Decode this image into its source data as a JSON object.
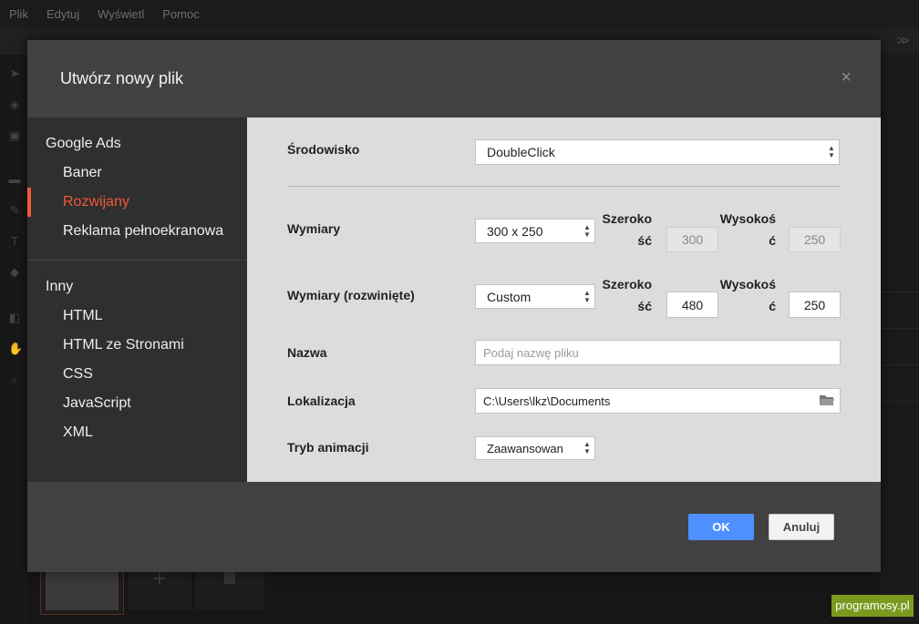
{
  "menu": [
    "Plik",
    "Edytuj",
    "Wyświetl",
    "Pomoc"
  ],
  "badge": "programosy.pl",
  "dialog": {
    "title": "Utwórz nowy plik",
    "close": "×",
    "sidebar": {
      "group1": {
        "title": "Google Ads",
        "items": [
          "Baner",
          "Rozwijany",
          "Reklama pełnoekranowa"
        ]
      },
      "group2": {
        "title": "Inny",
        "items": [
          "HTML",
          "HTML ze Stronami",
          "CSS",
          "JavaScript",
          "XML"
        ]
      },
      "active": "Rozwijany"
    },
    "form": {
      "environment": {
        "label": "Środowisko",
        "value": "DoubleClick"
      },
      "dimensions": {
        "label": "Wymiary",
        "value": "300 x 250",
        "width_label_1": "Szeroko",
        "width_label_2": "ść",
        "width": "300",
        "height_label_1": "Wysokoś",
        "height_label_2": "ć",
        "height": "250"
      },
      "dimensions_expanded": {
        "label": "Wymiary (rozwinięte)",
        "value": "Custom",
        "width_label_1": "Szeroko",
        "width_label_2": "ść",
        "width": "480",
        "height_label_1": "Wysokoś",
        "height_label_2": "ć",
        "height": "250"
      },
      "name": {
        "label": "Nazwa",
        "placeholder": "Podaj nazwę pliku"
      },
      "location": {
        "label": "Lokalizacja",
        "value": "C:\\Users\\lkz\\Documents"
      },
      "animation": {
        "label": "Tryb animacji",
        "value": "Zaawansowan"
      }
    },
    "buttons": {
      "ok": "OK",
      "cancel": "Anuluj"
    }
  },
  "colors": {
    "accent": "#f05a3a",
    "primary": "#4d90fe",
    "badge": "#7a9a1f"
  }
}
